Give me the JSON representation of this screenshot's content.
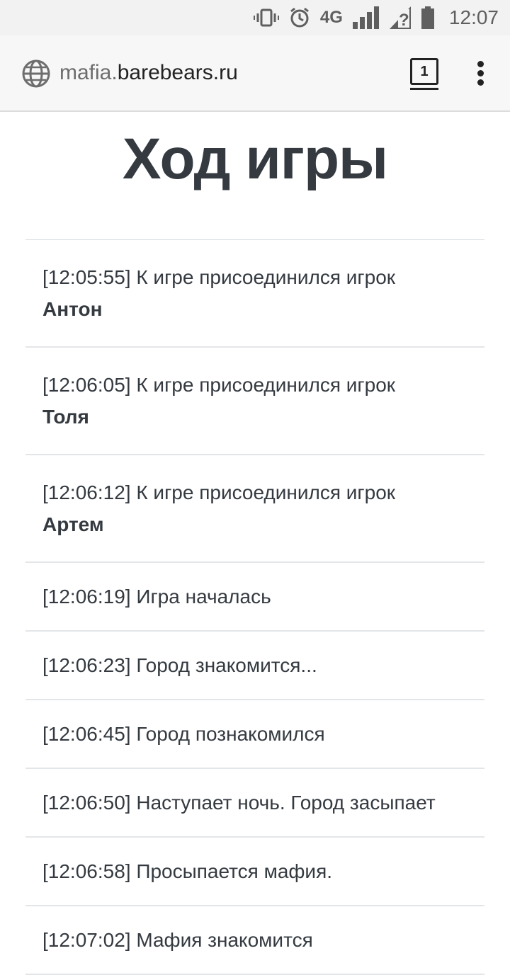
{
  "status_bar": {
    "icons": [
      "vibrate-icon",
      "alarm-icon",
      "signal-icon",
      "no-wifi-icon",
      "battery-icon"
    ],
    "network": "4G",
    "time": "12:07"
  },
  "browser": {
    "url_muted": "mafia.",
    "url_host": "barebears.ru",
    "tab_count": "1"
  },
  "page": {
    "title": "Ход игры"
  },
  "log": [
    {
      "time": "[12:05:55]",
      "text": "К игре присоединился игрок",
      "player": "Антон"
    },
    {
      "time": "[12:06:05]",
      "text": "К игре присоединился игрок",
      "player": "Толя"
    },
    {
      "time": "[12:06:12]",
      "text": "К игре присоединился игрок",
      "player": "Артем"
    },
    {
      "time": "[12:06:19]",
      "text": "Игра началась"
    },
    {
      "time": "[12:06:23]",
      "text": "Город знакомится..."
    },
    {
      "time": "[12:06:45]",
      "text": "Город познакомился"
    },
    {
      "time": "[12:06:50]",
      "text": "Наступает ночь. Город засыпает"
    },
    {
      "time": "[12:06:58]",
      "text": "Просыпается мафия."
    },
    {
      "time": "[12:07:02]",
      "text": "Мафия знакомится"
    }
  ]
}
